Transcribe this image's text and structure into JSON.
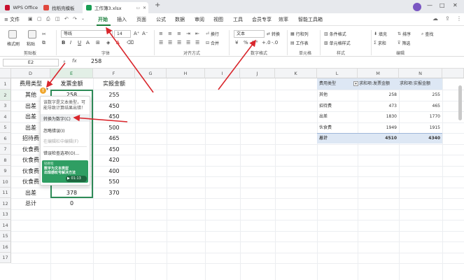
{
  "tabs": [
    {
      "label": "WPS Office"
    },
    {
      "label": "找稻壳模板"
    },
    {
      "label": "工作簿3.xlsx"
    }
  ],
  "new_tab_icon": "+",
  "window_controls": [
    "—",
    "□",
    "✕"
  ],
  "menu": {
    "file": "≡ 文件",
    "items": [
      "开始",
      "插入",
      "页面",
      "公式",
      "数据",
      "审阅",
      "视图",
      "工具",
      "会员专享",
      "效率",
      "智能工具箱"
    ]
  },
  "ribbon": {
    "format_painter": "格式刷",
    "paste": "粘贴",
    "clipboard": "剪贴板",
    "font_name": "等线",
    "font_size": "14",
    "font_group": "字体",
    "wrap_text": "换行",
    "merge": "合并",
    "align_group": "对齐方式",
    "number_format": "文本",
    "convert": "转换",
    "number_group": "数字格式",
    "rows_cols": "行和列",
    "worksheet": "工作表",
    "cells_group": "单元格",
    "conditional": "条件格式",
    "cell_style": "单元格样式",
    "style_group": "样式",
    "fill": "填充",
    "sum": "求和",
    "sort": "排序",
    "filter": "筛选",
    "find": "查找",
    "edit_group": "编辑"
  },
  "formula": {
    "name_box": "E2",
    "fx": "fx",
    "value": "258"
  },
  "columns": [
    "D",
    "E",
    "F",
    "G",
    "H",
    "I",
    "J",
    "K",
    "L",
    "M",
    "N"
  ],
  "rows": [
    "1",
    "2",
    "3",
    "4",
    "5",
    "6",
    "7",
    "8",
    "9",
    "10",
    "11",
    "12",
    "13",
    "14",
    "15",
    "16",
    "17"
  ],
  "table": {
    "headers": [
      "费用类型",
      "发票金额",
      "实报金额"
    ],
    "rows": [
      [
        "其他",
        "258",
        "255"
      ],
      [
        "出差",
        "",
        "450"
      ],
      [
        "出差",
        "",
        "450"
      ],
      [
        "出差",
        "",
        "500"
      ],
      [
        "招待费",
        "",
        "465"
      ],
      [
        "伙食费",
        "",
        "450"
      ],
      [
        "伙食费",
        "",
        "420"
      ],
      [
        "伙食费",
        "",
        "400"
      ],
      [
        "伙食费",
        "",
        "550"
      ],
      [
        "出差",
        "378",
        "370"
      ],
      [
        "总计",
        "0",
        ""
      ]
    ]
  },
  "pivot": {
    "headers": [
      "费用类型",
      "求和项:发票金额",
      "求和项:实报金额"
    ],
    "filter_icon": "▾",
    "rows": [
      [
        "其他",
        "258",
        "255"
      ],
      [
        "招待费",
        "473",
        "465"
      ],
      [
        "出差",
        "1830",
        "1770"
      ],
      [
        "伙食费",
        "1949",
        "1915"
      ]
    ],
    "total": [
      "总计",
      "4510",
      "4340"
    ]
  },
  "popup": {
    "warning_icon": "!",
    "description": "该数字是文本类型，可能导致计算结果出错！",
    "convert": "转换为数字(C)",
    "ignore": "忽略错误(I)",
    "edit_in_bar": "在编辑栏中编辑(F)",
    "options": "错误检查选项(O)...",
    "video_title": "数字为文本类型\n出现感叹号解决方法",
    "video_time": "01:13",
    "video_tag": "轻教程"
  },
  "colors": {
    "accent_green": "#1a7f3b",
    "selection_border": "#2e8b57",
    "arrow_red": "#d9262c",
    "pivot_header": "#dde7f4"
  }
}
